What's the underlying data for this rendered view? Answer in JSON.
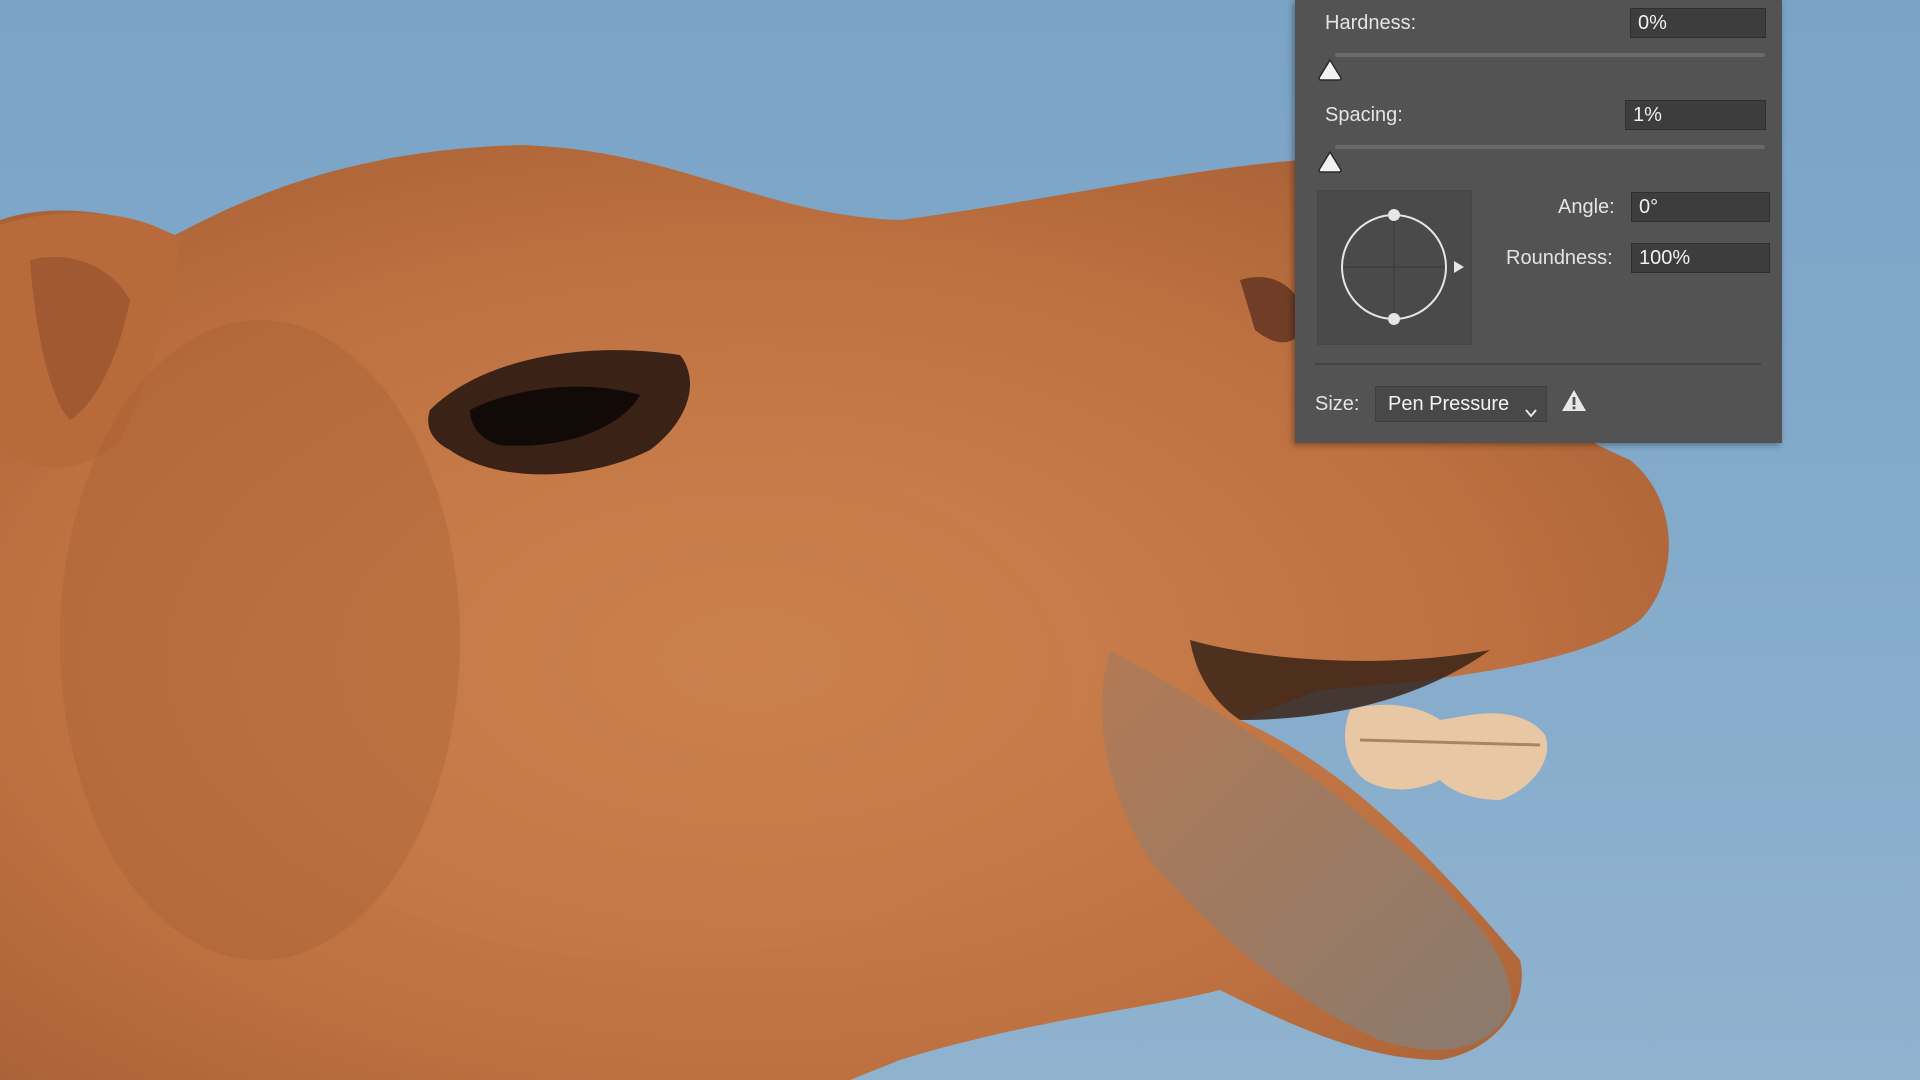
{
  "panel": {
    "hardness": {
      "label": "Hardness:",
      "value": "0%",
      "level": 0
    },
    "spacing": {
      "label": "Spacing:",
      "value": "1%",
      "level": 0.01
    },
    "angle": {
      "label": "Angle:",
      "value": "0°"
    },
    "roundness": {
      "label": "Roundness:",
      "value": "100%"
    },
    "size": {
      "label": "Size:",
      "control": "Pen Pressure"
    }
  },
  "icons": {
    "dropdown": "chevron-down-icon",
    "warning": "warning-icon",
    "slider": "slider-thumb-icon",
    "angle_preview": "brush-angle-preview-icon"
  },
  "colors": {
    "panel_bg": "#535353",
    "field_bg": "#3d3d3d",
    "sky": "#7ea4c4",
    "fur": "#c4773f"
  }
}
